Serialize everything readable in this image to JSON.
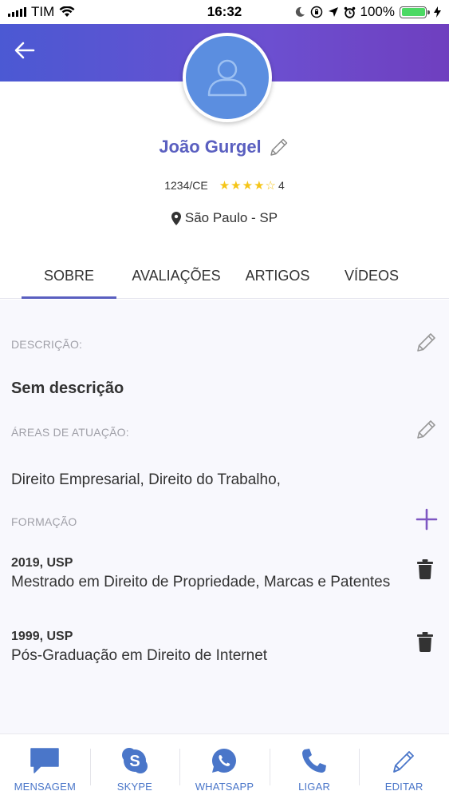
{
  "status_bar": {
    "carrier": "TIM",
    "time": "16:32",
    "battery": "100%"
  },
  "header": {
    "back_icon": "arrow-left-icon"
  },
  "profile": {
    "name": "João Gurgel",
    "registration": "1234/CE",
    "rating": 4,
    "rating_label": "4",
    "location": "São Paulo - SP",
    "accent_color": "#5a5fc0"
  },
  "tabs": [
    {
      "label": "SOBRE",
      "active": true
    },
    {
      "label": "AVALIAÇÕES",
      "active": false
    },
    {
      "label": "ARTIGOS",
      "active": false
    },
    {
      "label": "VÍDEOS",
      "active": false
    }
  ],
  "sections": {
    "description": {
      "label": "DESCRIÇÃO:",
      "value": "Sem descrição"
    },
    "areas": {
      "label": "ÁREAS DE ATUAÇÃO:",
      "value": "Direito Empresarial, Direito do Trabalho,"
    },
    "formation": {
      "label": "FORMAÇÃO",
      "items": [
        {
          "year_school": "2019, USP",
          "title": "Mestrado em Direito de Propriedade, Marcas e Patentes"
        },
        {
          "year_school": "1999, USP",
          "title": "Pós-Graduação em Direito de Internet"
        }
      ]
    }
  },
  "bottom_bar": [
    {
      "label": "MENSAGEM",
      "icon": "message-icon"
    },
    {
      "label": "SKYPE",
      "icon": "skype-icon"
    },
    {
      "label": "WHATSAPP",
      "icon": "whatsapp-icon"
    },
    {
      "label": "LIGAR",
      "icon": "phone-icon"
    },
    {
      "label": "EDITAR",
      "icon": "pencil-icon"
    }
  ]
}
